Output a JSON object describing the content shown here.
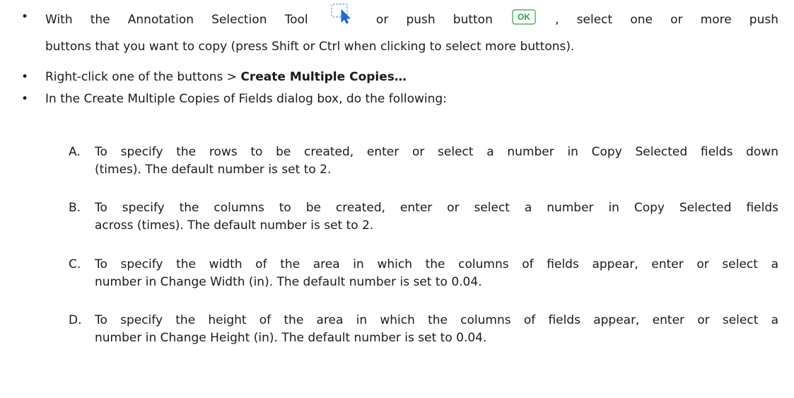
{
  "bullets": [
    {
      "line1_before": "With the Annotation Selection Tool",
      "line1_middle": "or push button",
      "line1_after": ", select one or more push",
      "line2": "buttons that you want to copy (press Shift or Ctrl when clicking to select more buttons).",
      "icon_selection_tool": "annotation-selection-tool-icon",
      "icon_ok_button": "ok-push-button-icon",
      "ok_label": "OK"
    },
    {
      "before": "Right-click one of the buttons > ",
      "bold": "Create Multiple Copies…"
    },
    {
      "text": "In the Create Multiple Copies of Fields dialog box, do the following:"
    }
  ],
  "steps": [
    {
      "letter": "A.",
      "line1": "To specify the rows to be created, enter or select a number in Copy Selected fields down",
      "line2": "(times). The default number is set to 2."
    },
    {
      "letter": "B.",
      "line1": "To specify the columns to be created, enter or select a number in Copy Selected fields",
      "line2": "across (times). The default number is set to 2."
    },
    {
      "letter": "C.",
      "line1": "To specify the width of the area in which the columns of fields appear, enter or select a",
      "line2": "number in Change Width (in). The default number is set to 0.04."
    },
    {
      "letter": "D.",
      "line1": "To specify the height of the area in which the columns of fields appear, enter or select a",
      "line2": "number in Change Height (in). The default number is set to 0.04."
    }
  ],
  "colors": {
    "text": "#1a1a1a",
    "ok_green": "#2e9e4f",
    "tool_blue": "#1f6fd6"
  }
}
